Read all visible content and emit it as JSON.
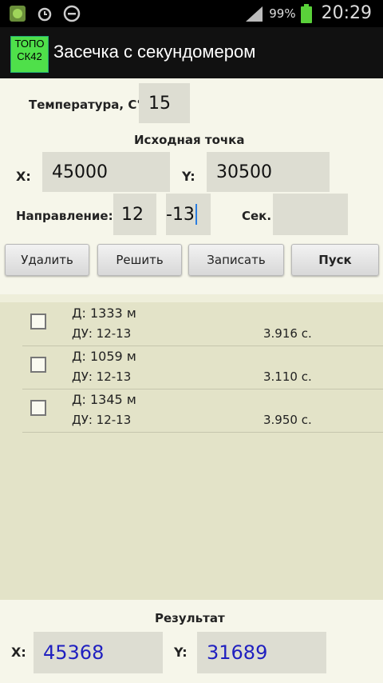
{
  "status_bar": {
    "battery_percent": "99%",
    "time": "20:29"
  },
  "app": {
    "logo_line1": "ТОПО",
    "logo_line2": "СК42",
    "title": "Засечка с секундомером"
  },
  "form": {
    "temperature_label": "Температура, С°",
    "temperature_value": "15",
    "origin_header": "Исходная точка",
    "x_label": "X:",
    "x_value": "45000",
    "y_label": "Y:",
    "y_value": "30500",
    "direction_label": "Направление:",
    "direction_major": "12",
    "direction_minor": "-13",
    "sec_label": "Сек.",
    "sec_value": ""
  },
  "buttons": {
    "delete": "Удалить",
    "solve": "Решить",
    "record": "Записать",
    "start": "Пуск"
  },
  "records": [
    {
      "distance": "Д: 1333 м",
      "du": "ДУ: 12-13",
      "seconds": "3.916 с."
    },
    {
      "distance": "Д: 1059 м",
      "du": "ДУ: 12-13",
      "seconds": "3.110 с."
    },
    {
      "distance": "Д: 1345 м",
      "du": "ДУ: 12-13",
      "seconds": "3.950 с."
    }
  ],
  "result": {
    "header": "Результат",
    "x_label": "X:",
    "x_value": "45368",
    "y_label": "Y:",
    "y_value": "31689"
  },
  "colors": {
    "result_value": "#2020c0",
    "battery": "#5ad13a",
    "logo_bg": "#4fe04a"
  }
}
